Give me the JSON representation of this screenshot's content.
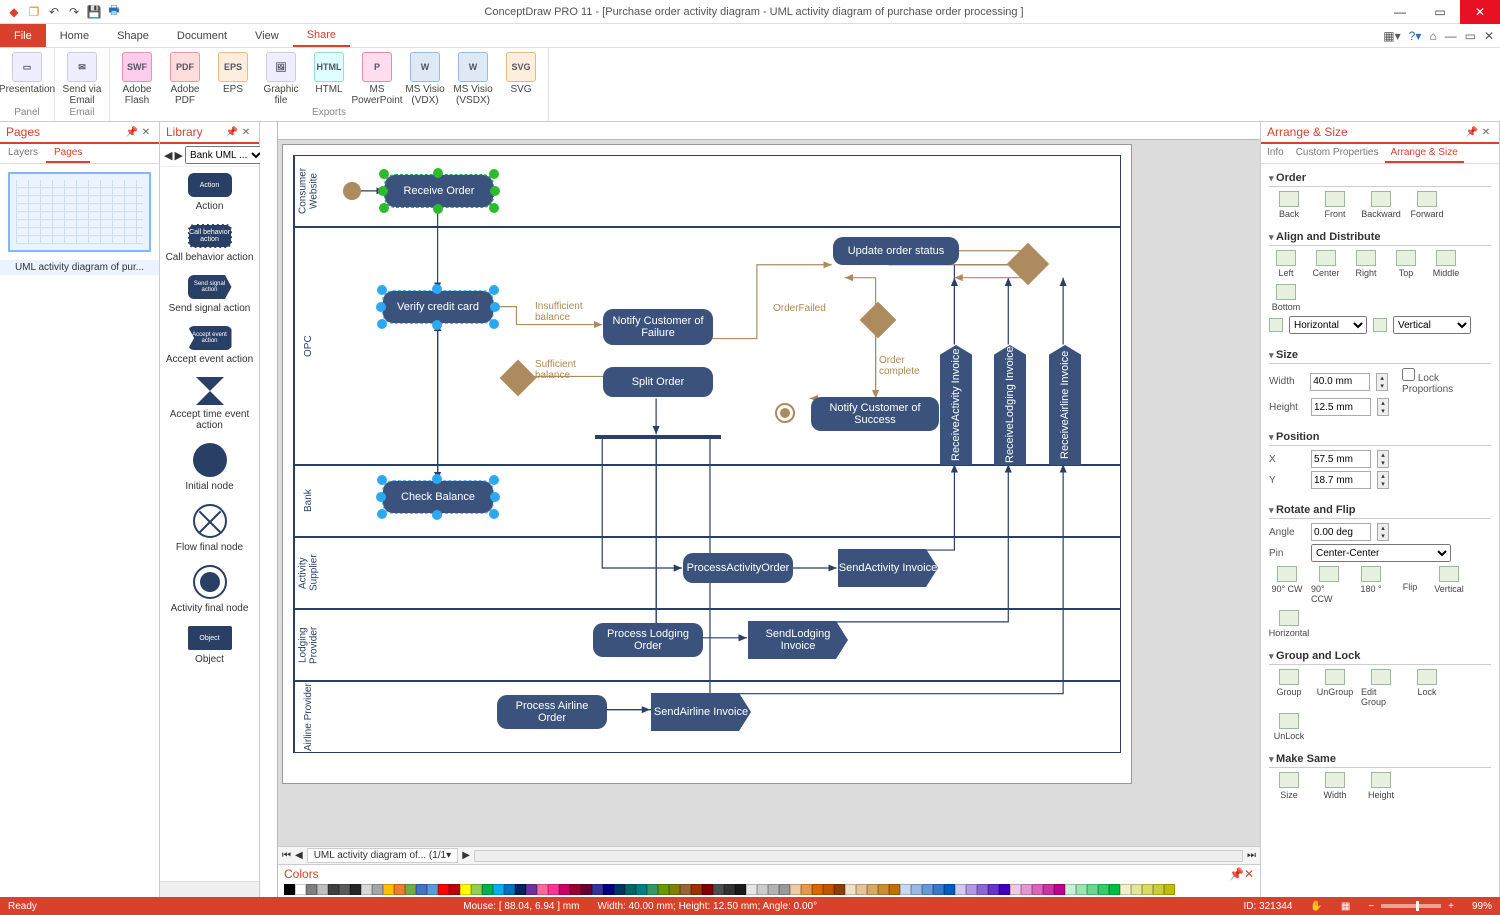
{
  "app": {
    "title": "ConceptDraw PRO 11 - [Purchase order activity diagram - UML activity diagram of purchase order processing ]"
  },
  "ribbon_tabs": {
    "file": "File",
    "home": "Home",
    "shape": "Shape",
    "document": "Document",
    "view": "View",
    "share": "Share"
  },
  "ribbon": {
    "panel": {
      "presentation": "Presentation",
      "label": "Panel"
    },
    "email": {
      "send": "Send via Email",
      "label": "Email"
    },
    "exports": {
      "adobe_flash": "Adobe Flash",
      "adobe_pdf": "Adobe PDF",
      "eps": "EPS",
      "graphic": "Graphic file",
      "html": "HTML",
      "ppt": "MS PowerPoint",
      "visio_vdx": "MS Visio (VDX)",
      "visio_vsdx": "MS Visio (VSDX)",
      "svg": "SVG",
      "label": "Exports"
    },
    "icons": {
      "pres": "▭",
      "mail": "✉",
      "swf": "SWF",
      "pdf": "PDF",
      "eps": "EPS",
      "img": "🖼",
      "html": "HTML",
      "ppt": "P",
      "vdx": "W",
      "vsdx": "W",
      "svg": "SVG"
    }
  },
  "pages_panel": {
    "title": "Pages",
    "tab_layers": "Layers",
    "tab_pages": "Pages",
    "thumb_label": "UML activity diagram of pur..."
  },
  "library": {
    "title": "Library",
    "dropdown": "Bank UML ...",
    "items": {
      "action": "Action",
      "call_behavior": "Call behavior action",
      "send_signal": "Send signal action",
      "accept_event": "Accept event action",
      "accept_time": "Accept time event action",
      "initial": "Initial node",
      "flow_final": "Flow final node",
      "activity_final": "Activity final node",
      "object": "Object"
    },
    "shape_text": {
      "action": "Action",
      "call": "Call behavior action",
      "send": "Send signal action",
      "accept": "Accept event action",
      "object": "Object"
    }
  },
  "canvas": {
    "lanes": {
      "consumer": "Consumer Website",
      "opc": "OPC",
      "bank": "Bank",
      "activity": "Activity Supplier",
      "lodging": "Lodging Provider",
      "airline": "Airline Provider"
    },
    "nodes": {
      "receive_order": "Receive Order",
      "verify_cc": "Verify credit card",
      "check_balance": "Check Balance",
      "notify_failure": "Notify Customer of Failure",
      "split_order": "Split Order",
      "update_status": "Update order status",
      "notify_success": "Notify Customer of Success",
      "process_activity": "ProcessActivityOrder",
      "send_activity": "SendActivity Invoice",
      "process_lodging": "Process Lodging Order",
      "send_lodging": "SendLodging Invoice",
      "process_airline": "Process Airline Order",
      "send_airline": "SendAirline Invoice",
      "recv_activity": "ReceiveActivity Invoice",
      "recv_lodging": "ReceiveLodging Invoice",
      "recv_airline": "ReceiveAirline Invoice"
    },
    "edge_labels": {
      "insufficient": "Insufficient balance",
      "sufficient": "Sufficient balance",
      "order_failed": "OrderFailed",
      "order_complete": "Order complete"
    }
  },
  "sheet_tab": "UML activity diagram of...  (1/1",
  "colors_title": "Colors",
  "arrange": {
    "title": "Arrange & Size",
    "tabs": {
      "info": "Info",
      "custom": "Custom Properties",
      "arrange": "Arrange & Size"
    },
    "order": {
      "h": "Order",
      "back": "Back",
      "front": "Front",
      "backward": "Backward",
      "forward": "Forward"
    },
    "align": {
      "h": "Align and Distribute",
      "left": "Left",
      "center": "Center",
      "right": "Right",
      "top": "Top",
      "middle": "Middle",
      "bottom": "Bottom",
      "horizontal": "Horizontal",
      "vertical": "Vertical"
    },
    "size": {
      "h": "Size",
      "width_l": "Width",
      "width_v": "40.0 mm",
      "height_l": "Height",
      "height_v": "12.5 mm",
      "lock": "Lock Proportions"
    },
    "position": {
      "h": "Position",
      "x_l": "X",
      "x_v": "57.5 mm",
      "y_l": "Y",
      "y_v": "18.7 mm"
    },
    "rotate": {
      "h": "Rotate and Flip",
      "angle_l": "Angle",
      "angle_v": "0.00 deg",
      "pin_l": "Pin",
      "pin_v": "Center-Center",
      "cw": "90° CW",
      "ccw": "90° CCW",
      "r180": "180 °",
      "flip": "Flip",
      "vert": "Vertical",
      "horiz": "Horizontal"
    },
    "group": {
      "h": "Group and Lock",
      "group": "Group",
      "ungroup": "UnGroup",
      "edit": "Edit Group",
      "lock": "Lock",
      "unlock": "UnLock"
    },
    "same": {
      "h": "Make Same",
      "size": "Size",
      "width": "Width",
      "height": "Height"
    }
  },
  "status": {
    "ready": "Ready",
    "mouse": "Mouse: [ 88.04, 6.94 ] mm",
    "dims": "Width: 40.00 mm;  Height: 12.50 mm;  Angle: 0.00°",
    "id": "ID: 321344",
    "zoom": "99%"
  },
  "swatch_colors": [
    "#000",
    "#fff",
    "#7f7f7f",
    "#bfbfbf",
    "#3f3f3f",
    "#595959",
    "#262626",
    "#d8d8d8",
    "#a5a5a5",
    "#ffc000",
    "#ed7d31",
    "#70ad47",
    "#4472c4",
    "#5b9bd5",
    "#ff0000",
    "#c00000",
    "#ffff00",
    "#92d050",
    "#00b050",
    "#00b0f0",
    "#0070c0",
    "#002060",
    "#7030a0",
    "#ff6699",
    "#ff3399",
    "#cc0066",
    "#990033",
    "#660033",
    "#333399",
    "#000080",
    "#003366",
    "#006666",
    "#008080",
    "#339966",
    "#669900",
    "#808000",
    "#996633",
    "#993300",
    "#800000",
    "#4d4d4d",
    "#333",
    "#1a1a1a",
    "#e6e6e6",
    "#ccc",
    "#b3b3b3",
    "#999",
    "#f2c9a0",
    "#e6994d",
    "#d96600",
    "#bf5500",
    "#8c3f00",
    "#f2e0c9",
    "#e6c499",
    "#d9a866",
    "#cc8c33",
    "#bf7000",
    "#c9d8f2",
    "#99b8e6",
    "#6699d9",
    "#3379cc",
    "#005abf",
    "#d4c9f2",
    "#b099e6",
    "#8c66d9",
    "#6633cc",
    "#4000bf",
    "#f2c9e4",
    "#e699cf",
    "#d966ba",
    "#cc33a4",
    "#bf008f",
    "#c9f2d4",
    "#99e6b0",
    "#66d98c",
    "#33cc66",
    "#00bf40",
    "#f2f2c9",
    "#e6e699",
    "#d9d966",
    "#cccc33",
    "#bfbf00"
  ]
}
